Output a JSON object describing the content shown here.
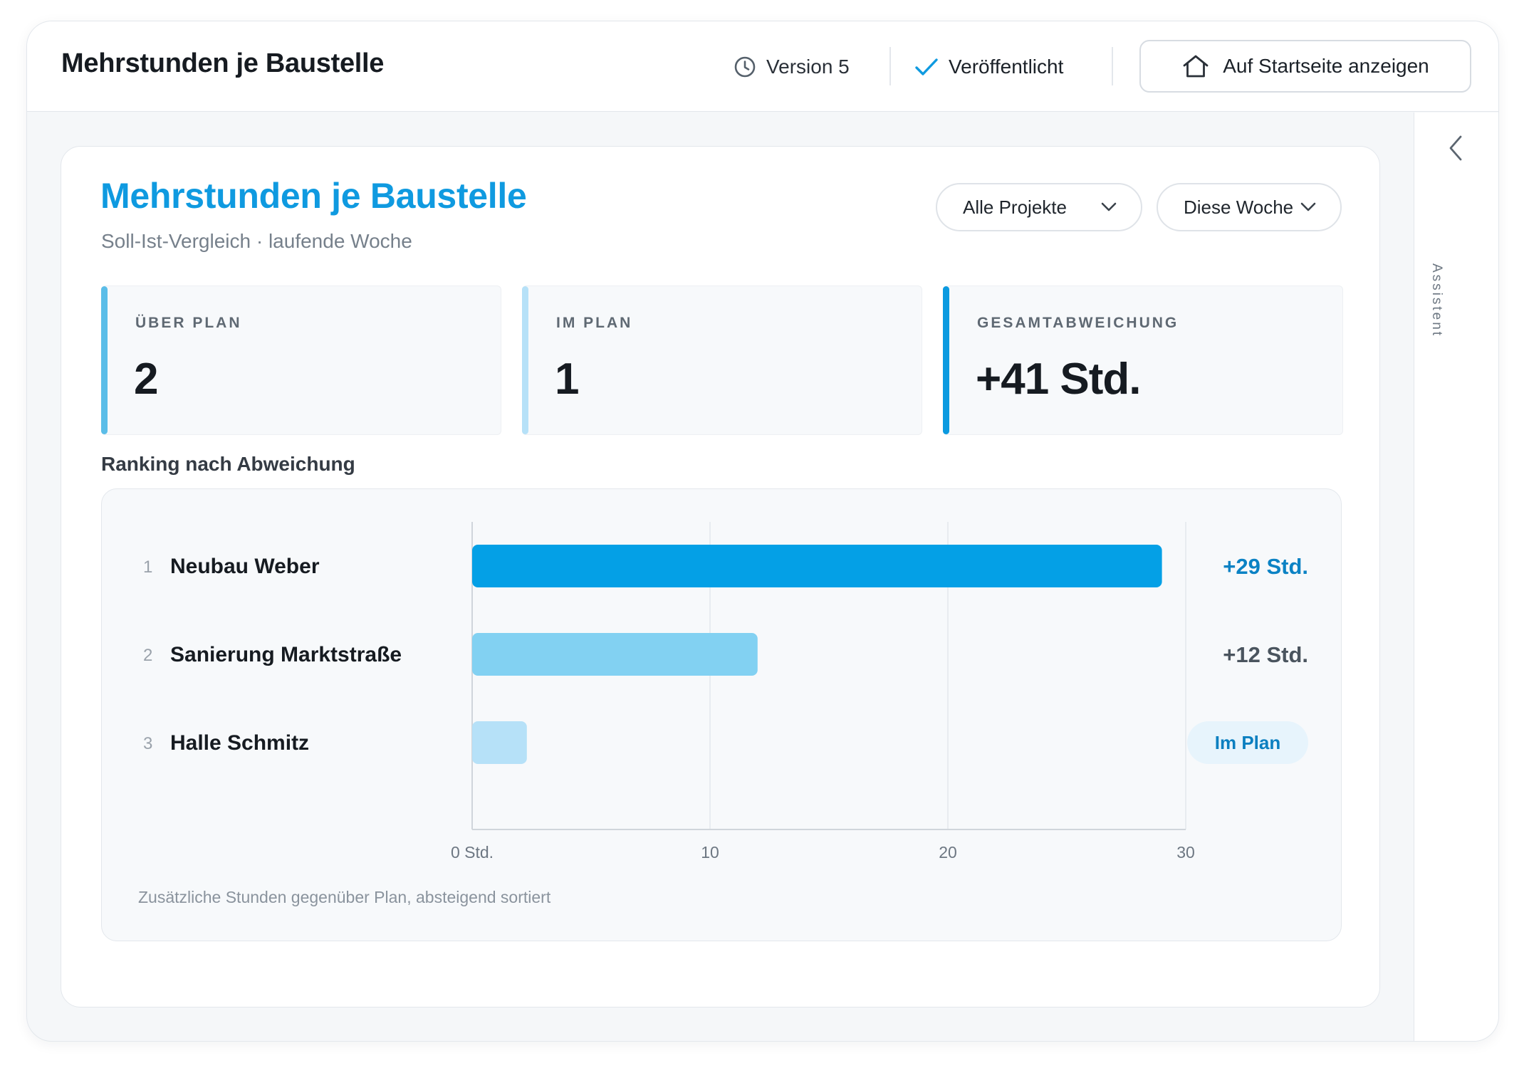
{
  "header": {
    "title": "Mehrstunden je Baustelle",
    "version_label": "Version 5",
    "status_label": "Veröffentlicht",
    "home_button_label": "Auf Startseite anzeigen"
  },
  "rail": {
    "label": "Assistent"
  },
  "card": {
    "title": "Mehrstunden je Baustelle",
    "subtitle": "Soll-Ist-Vergleich · laufende Woche",
    "filters": {
      "project": "Alle Projekte",
      "period": "Diese Woche"
    }
  },
  "kpis": [
    {
      "label": "ÜBER PLAN",
      "value": "2"
    },
    {
      "label": "IM PLAN",
      "value": "1"
    },
    {
      "label": "GESAMTABWEICHUNG",
      "value": "+41 Std."
    }
  ],
  "ranking": {
    "heading": "Ranking nach Abweichung",
    "footnote": "Zusätzliche Stunden gegenüber Plan, absteigend sortiert"
  },
  "colors": {
    "accent": "#0f9ae0",
    "bar_primary": "#04a0e6",
    "bar_secondary": "#82d1f2",
    "bar_tertiary": "#b6e1f8",
    "kpi_bar_1": "#5bbde8",
    "kpi_bar_2": "#b6e1f8",
    "kpi_bar_3": "#0b9ae0",
    "badge_bg": "#e7f4fc",
    "badge_text": "#0b7fc0"
  },
  "chart_data": {
    "type": "bar",
    "orientation": "horizontal",
    "categories": [
      "Neubau Weber",
      "Sanierung Marktstraße",
      "Halle Schmitz"
    ],
    "ranks": [
      "1",
      "2",
      "3"
    ],
    "values": [
      29,
      12,
      2.3
    ],
    "value_labels": [
      "+29 Std.",
      "+12 Std.",
      "Im Plan"
    ],
    "x_ticks": [
      0,
      10,
      20,
      30
    ],
    "x_tick_labels": [
      "0 Std.",
      "10",
      "20",
      "30"
    ],
    "xlim": [
      0,
      30
    ],
    "grid": true
  }
}
